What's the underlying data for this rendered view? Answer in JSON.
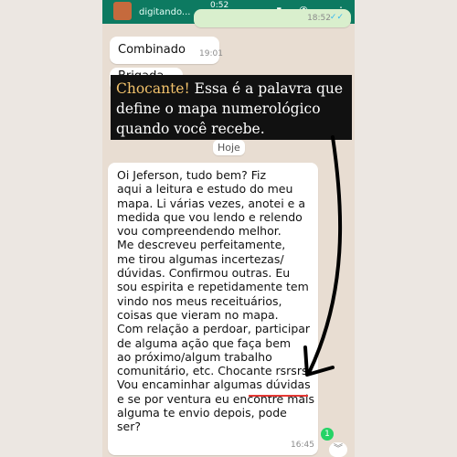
{
  "header": {
    "typing_text": "digitando...",
    "status_time": "0:52",
    "out_time": "18:52"
  },
  "messages": {
    "m1": {
      "text": "Combinado",
      "time": "19:01"
    },
    "m2": {
      "text": "Brigada"
    },
    "day_label": "Hoje",
    "main": {
      "lines": "Oi Jeferson, tudo bem? Fiz\naqui a leitura e estudo do meu\nmapa. Li várias vezes, anotei e a\nmedida que vou lendo e relendo\nvou compreendendo melhor.\nMe descreveu perfeitamente,\nme tirou algumas incertezas/\ndúvidas. Confirmou outras. Eu\nsou espirita e repetidamente tem\nvindo nos meus receituários,\ncoisas que vieram no mapa.\nCom relação a perdoar, participar\nde alguma ação que faça bem\nao próximo/algum trabalho\ncomunitário, etc. Chocante rsrsrs\nVou encaminhar algumas dúvidas\ne se por ventura eu encontre mais\nalguma te envio depois, pode\nser?",
      "time": "16:45"
    },
    "unread_count": "1"
  },
  "overlay": {
    "highlight": "Chocante!",
    "rest": " Essa é a palavra que define o mapa numerológico quando você recebe."
  },
  "colors": {
    "header": "#0d7a61",
    "overlay_bg": "#111111",
    "highlight": "#f2c26b",
    "underline": "#e53935"
  }
}
